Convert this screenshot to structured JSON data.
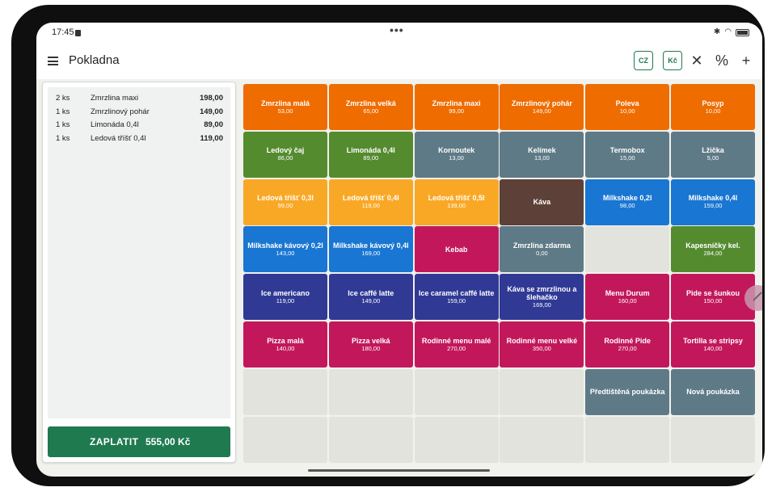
{
  "status": {
    "time": "17:45"
  },
  "appbar": {
    "title": "Pokladna",
    "language_label": "CZ",
    "currency_label": "Kč",
    "close_symbol": "✕",
    "discount_symbol": "%",
    "add_symbol": "+"
  },
  "order": {
    "items": [
      {
        "qty": "2 ks",
        "name": "Zmrzlina maxi",
        "price": "198,00"
      },
      {
        "qty": "1 ks",
        "name": "Zmrzlinový pohár",
        "price": "149,00"
      },
      {
        "qty": "1 ks",
        "name": "Limonáda 0,4l",
        "price": "89,00"
      },
      {
        "qty": "1 ks",
        "name": "Ledová tříšť 0,4l",
        "price": "119,00"
      }
    ]
  },
  "pay": {
    "label": "ZAPLATIT",
    "total": "555,00 Kč"
  },
  "colors": {
    "orange": "#ef6c00",
    "green": "#558b2f",
    "slate": "#5f7a87",
    "amber": "#f9a825",
    "brown": "#5d4037",
    "blue": "#1976d2",
    "magenta": "#c2185b",
    "indigo": "#303a95",
    "accent": "#1f7a50"
  },
  "products": [
    {
      "name": "Zmrzlina malá",
      "price": "53,00",
      "color": "#ef6c00"
    },
    {
      "name": "Zmrzlina velká",
      "price": "65,00",
      "color": "#ef6c00"
    },
    {
      "name": "Zmrzlina maxi",
      "price": "99,00",
      "color": "#ef6c00"
    },
    {
      "name": "Zmrzlinový pohár",
      "price": "149,00",
      "color": "#ef6c00"
    },
    {
      "name": "Poleva",
      "price": "10,00",
      "color": "#ef6c00"
    },
    {
      "name": "Posyp",
      "price": "10,00",
      "color": "#ef6c00"
    },
    {
      "name": "Ledový čaj",
      "price": "86,00",
      "color": "#558b2f"
    },
    {
      "name": "Limonáda 0,4l",
      "price": "89,00",
      "color": "#558b2f"
    },
    {
      "name": "Kornoutek",
      "price": "13,00",
      "color": "#5f7a87"
    },
    {
      "name": "Kelímek",
      "price": "13,00",
      "color": "#5f7a87"
    },
    {
      "name": "Termobox",
      "price": "15,00",
      "color": "#5f7a87"
    },
    {
      "name": "Lžička",
      "price": "5,00",
      "color": "#5f7a87"
    },
    {
      "name": "Ledová tříšť 0,3l",
      "price": "99,00",
      "color": "#f9a825"
    },
    {
      "name": "Ledová tříšť 0,4l",
      "price": "119,00",
      "color": "#f9a825"
    },
    {
      "name": "Ledová tříšť 0,5l",
      "price": "139,00",
      "color": "#f9a825"
    },
    {
      "name": "Káva",
      "price": "",
      "color": "#5d4037"
    },
    {
      "name": "Milkshake 0,2l",
      "price": "98,00",
      "color": "#1976d2"
    },
    {
      "name": "Milkshake 0,4l",
      "price": "159,00",
      "color": "#1976d2"
    },
    {
      "name": "Milkshake kávový 0,2l",
      "price": "143,00",
      "color": "#1976d2"
    },
    {
      "name": "Milkshake kávový 0,4l",
      "price": "169,00",
      "color": "#1976d2"
    },
    {
      "name": "Kebab",
      "price": "",
      "color": "#c2185b"
    },
    {
      "name": "Zmrzlina zdarma",
      "price": "0,00",
      "color": "#5f7a87"
    },
    {
      "name": "",
      "price": "",
      "color": ""
    },
    {
      "name": "Kapesníčky kel.",
      "price": "284,00",
      "color": "#558b2f"
    },
    {
      "name": "Ice americano",
      "price": "119,00",
      "color": "#303a95"
    },
    {
      "name": "Ice caffé latte",
      "price": "149,00",
      "color": "#303a95"
    },
    {
      "name": "Ice caramel caffé latte",
      "price": "159,00",
      "color": "#303a95"
    },
    {
      "name": "Káva se zmrzlinou a šlehačko",
      "price": "169,00",
      "color": "#303a95"
    },
    {
      "name": "Menu Durum",
      "price": "160,00",
      "color": "#c2185b"
    },
    {
      "name": "Pide se šunkou",
      "price": "150,00",
      "color": "#c2185b"
    },
    {
      "name": "Pizza malá",
      "price": "140,00",
      "color": "#c2185b"
    },
    {
      "name": "Pizza velká",
      "price": "180,00",
      "color": "#c2185b"
    },
    {
      "name": "Rodinné menu malé",
      "price": "270,00",
      "color": "#c2185b"
    },
    {
      "name": "Rodinné menu velké",
      "price": "350,00",
      "color": "#c2185b"
    },
    {
      "name": "Rodinné Pide",
      "price": "270,00",
      "color": "#c2185b"
    },
    {
      "name": "Tortilla se stripsy",
      "price": "140,00",
      "color": "#c2185b"
    },
    {
      "name": "",
      "price": "",
      "color": ""
    },
    {
      "name": "",
      "price": "",
      "color": ""
    },
    {
      "name": "",
      "price": "",
      "color": ""
    },
    {
      "name": "",
      "price": "",
      "color": ""
    },
    {
      "name": "Předtištěná poukázka",
      "price": "",
      "color": "#5f7a87"
    },
    {
      "name": "Nová poukázka",
      "price": "",
      "color": "#5f7a87"
    },
    {
      "name": "",
      "price": "",
      "color": ""
    },
    {
      "name": "",
      "price": "",
      "color": ""
    },
    {
      "name": "",
      "price": "",
      "color": ""
    },
    {
      "name": "",
      "price": "",
      "color": ""
    },
    {
      "name": "",
      "price": "",
      "color": ""
    },
    {
      "name": "",
      "price": "",
      "color": ""
    }
  ]
}
